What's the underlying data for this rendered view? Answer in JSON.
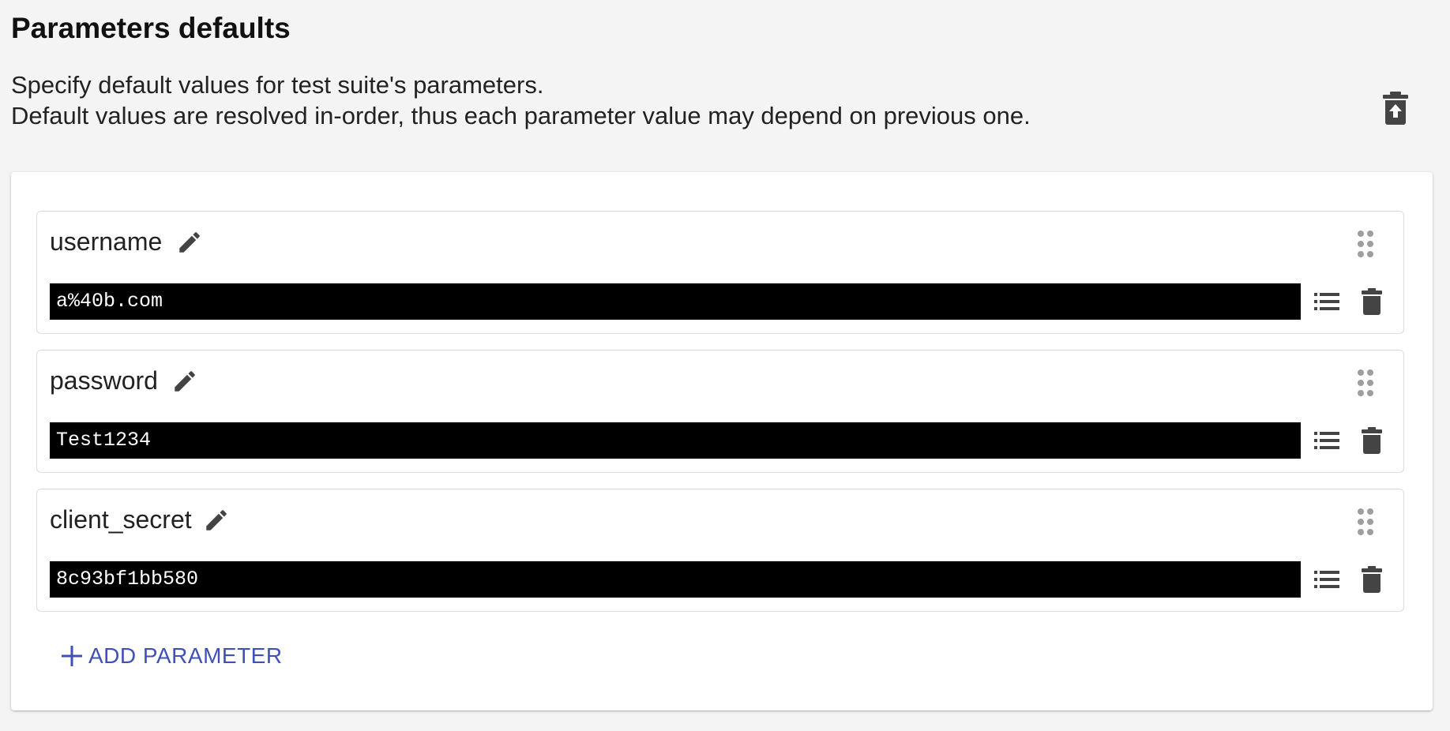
{
  "header": {
    "title": "Parameters defaults",
    "description_line1": "Specify default values for test suite's parameters.",
    "description_line2": "Default values are resolved in-order, thus each parameter value may depend on previous one."
  },
  "icons": {
    "clear_all": "delete-sweep-icon",
    "edit": "pencil-icon",
    "drag": "drag-handle-icon",
    "list": "list-icon",
    "delete": "trash-icon",
    "add": "plus-icon"
  },
  "parameters": [
    {
      "name": "username",
      "value": "a%40b.com"
    },
    {
      "name": "password",
      "value": "Test1234"
    },
    {
      "name": "client_secret",
      "value": "8c93bf1bb580"
    }
  ],
  "actions": {
    "add_parameter_label": "ADD PARAMETER"
  },
  "colors": {
    "accent": "#3f51b5",
    "icon": "#444444",
    "drag_icon": "#9e9e9e",
    "input_bg": "#000000",
    "input_text": "#ffffff",
    "page_bg": "#f4f4f4"
  }
}
